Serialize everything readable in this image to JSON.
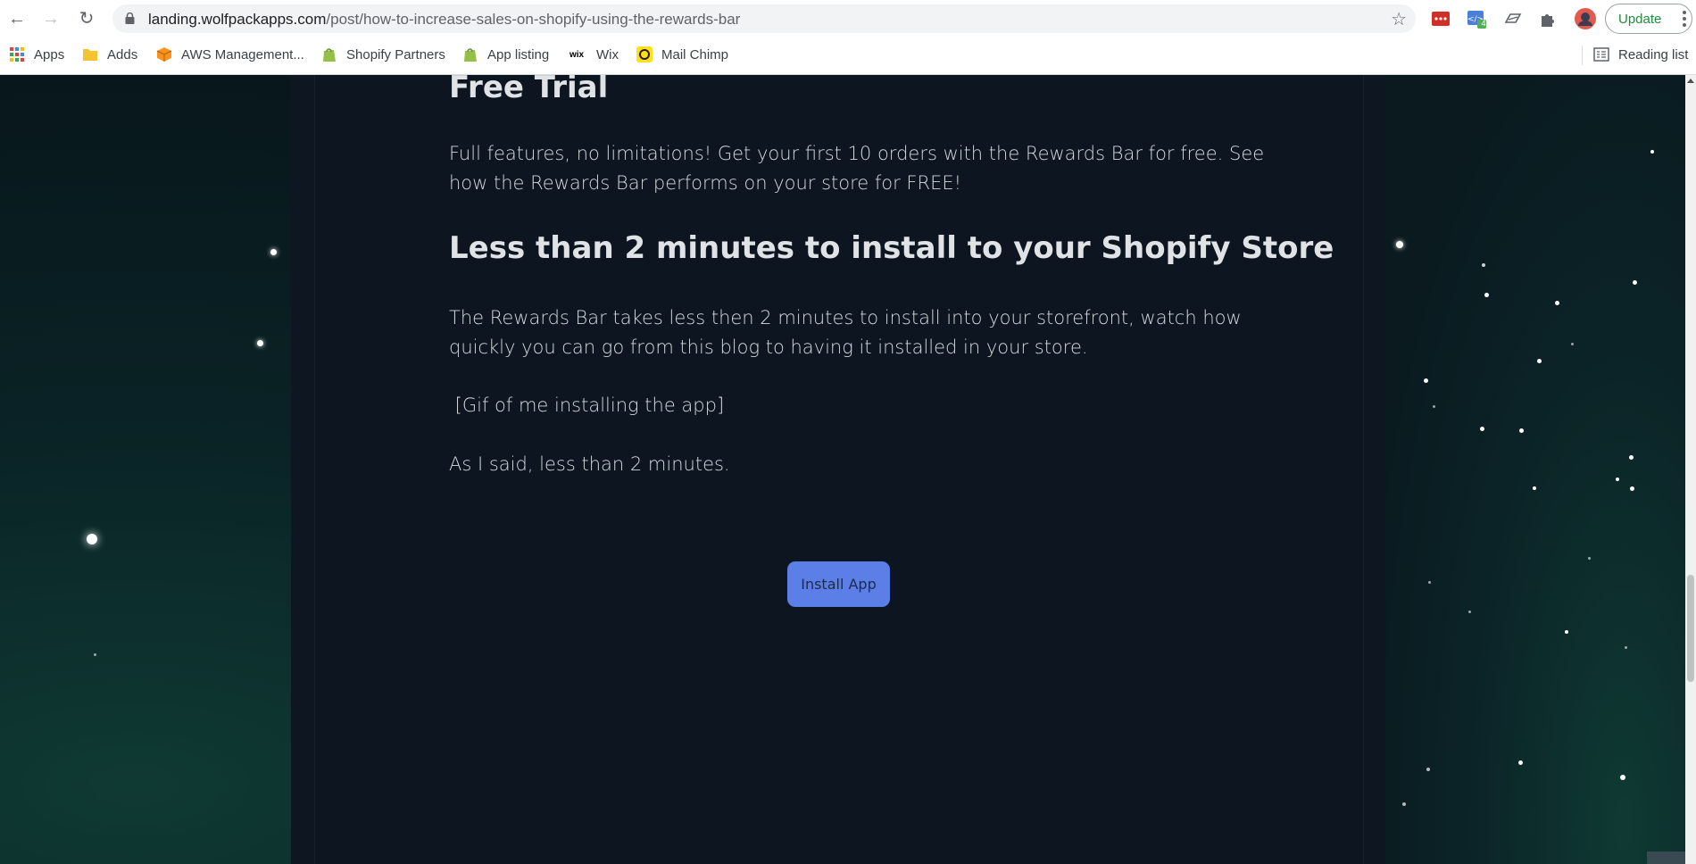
{
  "browser": {
    "url_host": "landing.wolfpackapps.com",
    "url_path": "/post/how-to-increase-sales-on-shopify-using-the-rewards-bar",
    "update_label": "Update",
    "extension_badge": "4"
  },
  "bookmarks": {
    "items": [
      {
        "label": "Apps",
        "icon": "apps-grid-icon"
      },
      {
        "label": "Adds",
        "icon": "folder-icon"
      },
      {
        "label": "AWS Management...",
        "icon": "aws-cube-icon"
      },
      {
        "label": "Shopify Partners",
        "icon": "shopify-bag-icon"
      },
      {
        "label": "App listing",
        "icon": "shopify-bag-icon"
      },
      {
        "label": "Wix",
        "icon": "wix-logo-icon"
      },
      {
        "label": "Mail Chimp",
        "icon": "mailchimp-icon"
      }
    ],
    "reading_list": "Reading list"
  },
  "article": {
    "heading_trial": "Free Trial",
    "paragraph_trial": "Full features, no limitations! Get your first 10 orders with the Rewards Bar for free. See how the Rewards Bar performs on your store for FREE!",
    "heading_install": "Less than 2 minutes to install to your Shopify Store",
    "paragraph_install": "The Rewards Bar takes less then 2 minutes to install into your storefront, watch how quickly you can go from this blog to having it installed in your store.",
    "paragraph_gif": " [Gif of me installing the app]",
    "paragraph_said": "As I said, less than 2 minutes.",
    "install_button": "Install App"
  },
  "colors": {
    "page_bg": "#0d1621",
    "button_bg": "#5b7fe6",
    "heading_text": "#dfe3e6",
    "update_text": "#1e8e3e"
  }
}
